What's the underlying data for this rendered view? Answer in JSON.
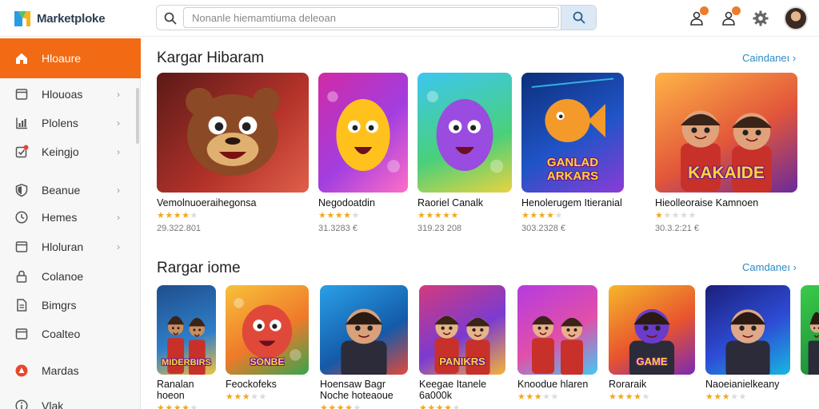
{
  "app": {
    "name": "Marketploke"
  },
  "search": {
    "placeholder": "Nonanle hiemamtiuma deleoan"
  },
  "sidebar": {
    "items": [
      {
        "label": "Hloaure",
        "icon": "home-icon",
        "active": true,
        "chevron": false
      },
      {
        "label": "Hlouoas",
        "icon": "window-icon",
        "chevron": true
      },
      {
        "label": "Plolens",
        "icon": "chart-icon",
        "chevron": true
      },
      {
        "label": "Keingjo",
        "icon": "check-box-icon",
        "chevron": true
      },
      {
        "label": "Beanue",
        "icon": "shield-icon",
        "chevron": true
      },
      {
        "label": "Hemes",
        "icon": "clock-icon",
        "chevron": true
      },
      {
        "label": "Hloluran",
        "icon": "window-icon",
        "chevron": true
      },
      {
        "label": "Colanoe",
        "icon": "lock-icon",
        "chevron": false
      },
      {
        "label": "Bimgrs",
        "icon": "document-icon",
        "chevron": false
      },
      {
        "label": "Coalteo",
        "icon": "window-icon",
        "chevron": false
      },
      {
        "label": "Mardas",
        "icon": "app-red-icon",
        "chevron": false
      },
      {
        "label": "Vlak",
        "icon": "info-icon",
        "chevron": false
      }
    ]
  },
  "sections": [
    {
      "title": "Kargar Hibaram",
      "see_all": "Caindaneı ›",
      "cards": [
        {
          "name": "Vemolnuoeraihegonsa",
          "rating": 4,
          "meta": "29.322.801"
        },
        {
          "name": "Negodoatdin",
          "rating": 4,
          "meta": "31.3283 €"
        },
        {
          "name": "Raoriel Canalk",
          "rating": 5,
          "meta": "319.23 208"
        },
        {
          "name": "Henolerugem Itieranial",
          "rating": 4,
          "meta": "303.2328 €"
        },
        {
          "name": "Hieolleoraise Kamnoen",
          "rating": 1,
          "meta": "30.3.2:21 €"
        }
      ]
    },
    {
      "title": "Rargar iome",
      "see_all": "Camdaneı ›",
      "cards": [
        {
          "name": "Ranalan",
          "name2": "hoeon",
          "rating": 4,
          "meta": ""
        },
        {
          "name": "Feockofeks",
          "name2": "",
          "rating": 3,
          "meta": ""
        },
        {
          "name": "Hoensaw Bagr",
          "name2": "Noche hoteaoue",
          "rating": 4,
          "meta": ""
        },
        {
          "name": "Keegae Itanele",
          "name2": "6a000k",
          "rating": 4,
          "meta": ""
        },
        {
          "name": "Knoodue hlaren",
          "name2": "",
          "rating": 3,
          "meta": ""
        },
        {
          "name": "Roraraik",
          "name2": "",
          "rating": 4,
          "meta": ""
        },
        {
          "name": "Naoeianielkeany",
          "name2": "",
          "rating": 3,
          "meta": ""
        }
      ]
    }
  ],
  "thumb_texts": {
    "s0c3": "GANLAD ARKARS",
    "s0c4": "KAKAIDE",
    "s1c0": "MIDERBIRS",
    "s1c1": "SONBE",
    "s1c3": "PANIKRS",
    "s1c5": "GAME"
  },
  "colors": {
    "accent": "#f26a13",
    "link": "#2a8bc6",
    "star": "#f2a81d"
  }
}
